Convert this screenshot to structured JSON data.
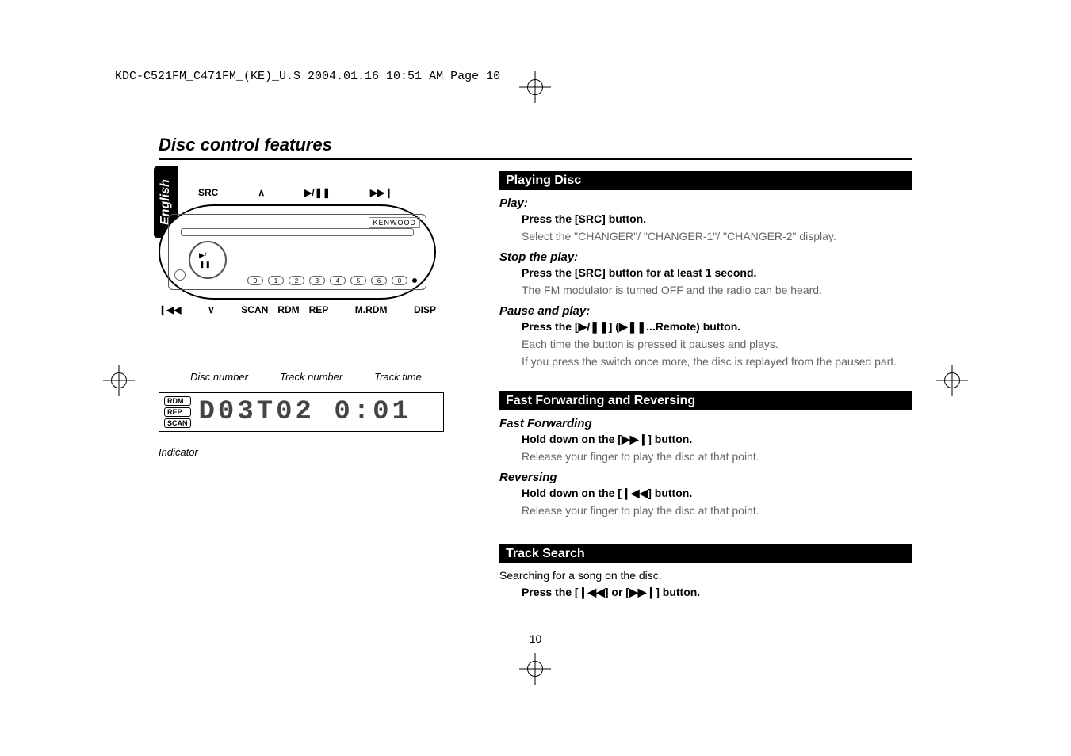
{
  "print_header": "KDC-C521FM_C471FM_(KE)_U.S  2004.01.16  10:51 AM  Page 10",
  "side_tab": "English",
  "section_title": "Disc control features",
  "device": {
    "brand": "KENWOOD",
    "top_labels": {
      "src": "SRC",
      "up": "∧",
      "play_pause": "▶/❚❚",
      "next": "▶▶❙"
    },
    "center_button": "▶/❚❚",
    "numbered_buttons": [
      "0",
      "1",
      "2",
      "3",
      "4",
      "5",
      "6",
      "0"
    ],
    "row_tiny_labels": [
      "",
      "",
      "SCAN",
      "RDM",
      "REP",
      "",
      "M.RDM",
      "DISP"
    ],
    "bottom_labels": {
      "prev": "❙◀◀",
      "down": "∨",
      "scan": "SCAN",
      "rdm": "RDM",
      "rep": "REP",
      "mrdm": "M.RDM",
      "disp": "DISP"
    }
  },
  "lcd": {
    "labels": {
      "disc_number": "Disc number",
      "track_number": "Track number",
      "track_time": "Track time"
    },
    "indicators": [
      "RDM",
      "REP",
      "SCAN"
    ],
    "display_text": "D03T02  0:01",
    "indicator_label": "Indicator"
  },
  "sections": {
    "playing": {
      "title": "Playing Disc",
      "play": {
        "head": "Play:",
        "line1": "Press the [SRC] button.",
        "line2": "Select the \"CHANGER\"/ \"CHANGER-1\"/ \"CHANGER-2\" display."
      },
      "stop": {
        "head": "Stop the play:",
        "line1": "Press the [SRC] button for at least 1 second.",
        "line2": "The FM modulator is turned OFF and the radio can be heard."
      },
      "pause": {
        "head": "Pause and play:",
        "line1": "Press the [▶/❚❚] (▶❚❚...Remote) button.",
        "line2": "Each time the button is pressed it pauses and plays.",
        "line3": "If you press the switch once more, the disc is replayed from the paused part."
      }
    },
    "ff": {
      "title": "Fast Forwarding and Reversing",
      "fwd": {
        "head": "Fast Forwarding",
        "line1": "Hold down on the [▶▶❙] button.",
        "line2": "Release your finger to play the disc at that point."
      },
      "rev": {
        "head": "Reversing",
        "line1": "Hold down on the [❙◀◀] button.",
        "line2": "Release your finger to play the disc at that point."
      }
    },
    "track": {
      "title": "Track Search",
      "desc": "Searching for a song on the disc.",
      "line1": "Press the [❙◀◀] or [▶▶❙] button."
    }
  },
  "page_number": "— 10 —"
}
